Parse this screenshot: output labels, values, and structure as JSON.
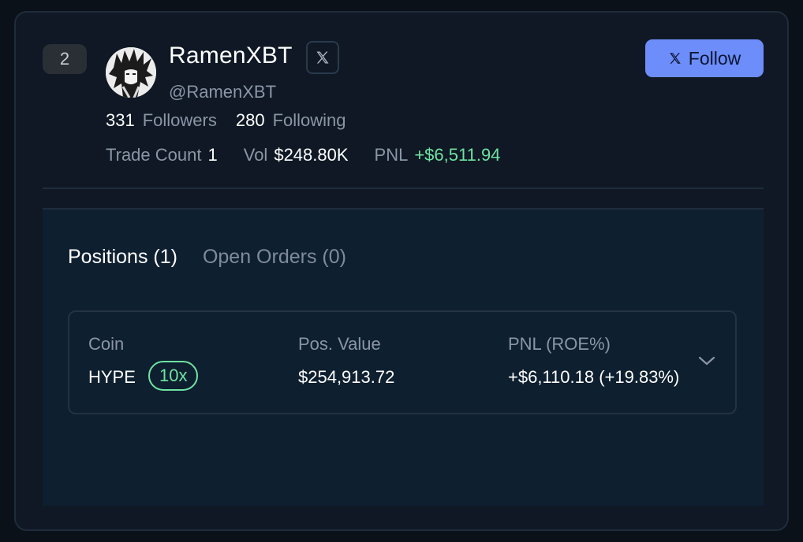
{
  "trader": {
    "rank": "2",
    "name": "RamenXBT",
    "handle": "@RamenXBT",
    "followers_count": "331",
    "followers_label": "Followers",
    "following_count": "280",
    "following_label": "Following",
    "trade_count_label": "Trade Count",
    "trade_count": "1",
    "vol_label": "Vol",
    "vol": "$248.80K",
    "pnl_label": "PNL",
    "pnl": "+$6,511.94"
  },
  "follow_button": {
    "label": "Follow",
    "icon": "x-logo-icon"
  },
  "tabs": [
    {
      "label": "Positions (1)",
      "active": true
    },
    {
      "label": "Open Orders (0)",
      "active": false
    }
  ],
  "position": {
    "coin_label": "Coin",
    "coin": "HYPE",
    "leverage": "10x",
    "pos_value_label": "Pos. Value",
    "pos_value": "$254,913.72",
    "pnl_label": "PNL (ROE%)",
    "pnl": "+$6,110.18 (+19.83%)"
  },
  "colors": {
    "background": "#0b1119",
    "card": "#0f1824",
    "accent": "#6c8dfa",
    "positive": "#6fe3a1",
    "muted": "#8a96a6"
  }
}
